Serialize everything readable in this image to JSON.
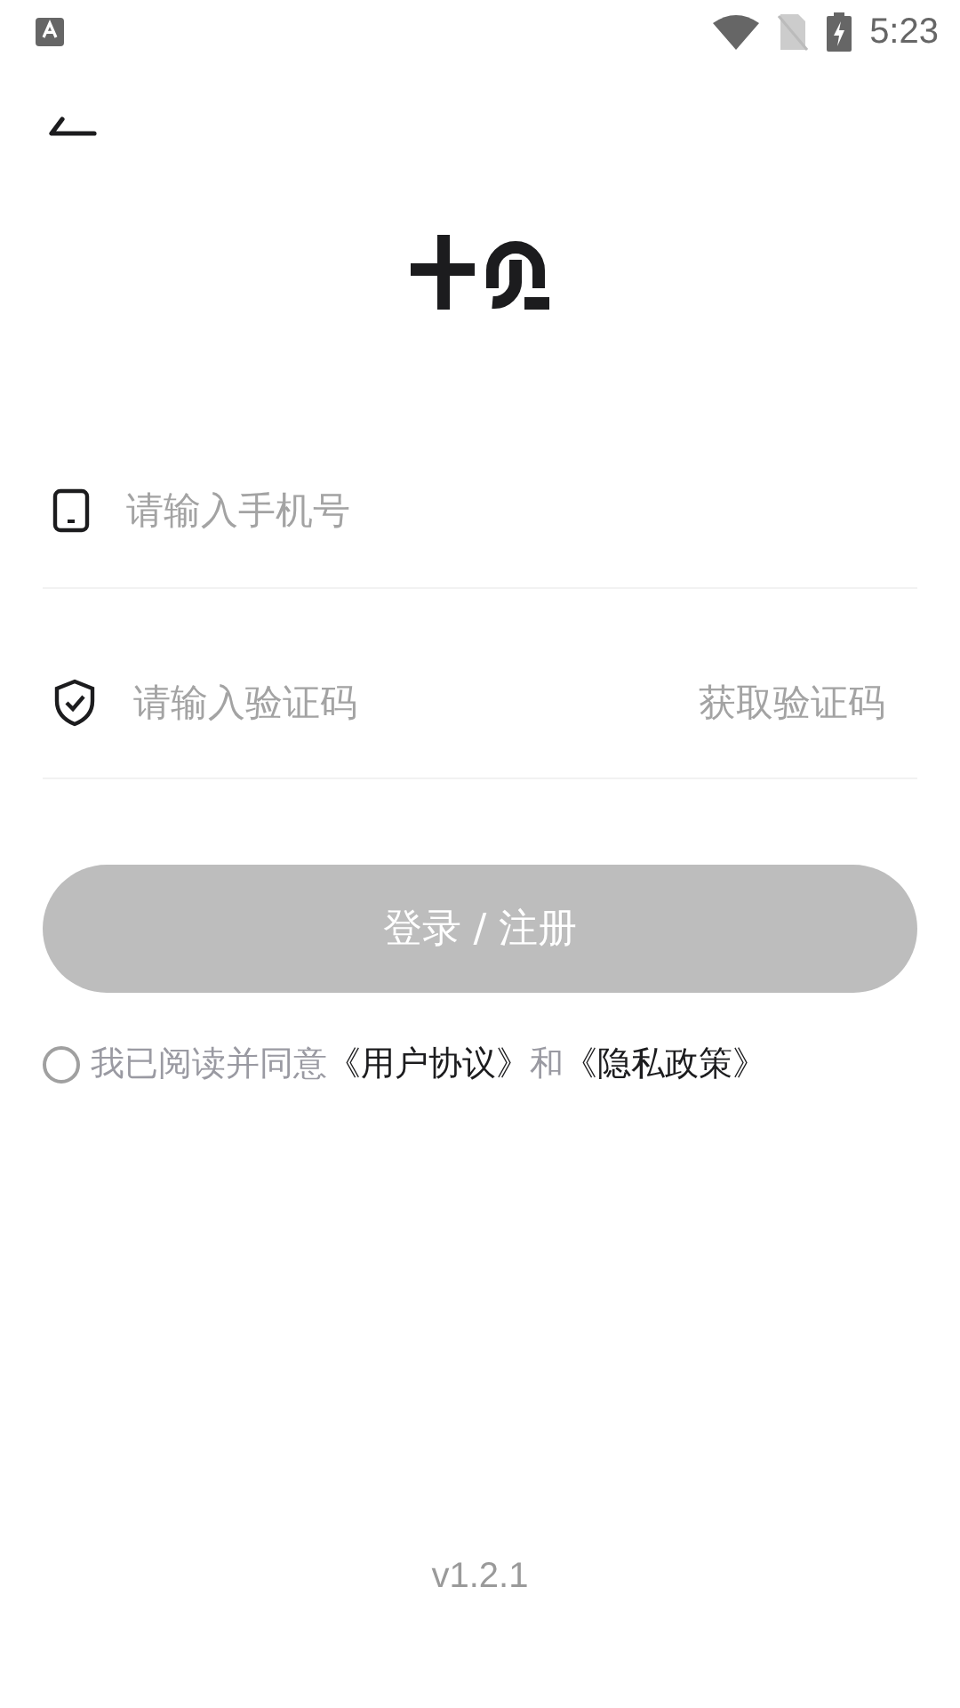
{
  "status_bar": {
    "time": "5:23"
  },
  "phone_field": {
    "placeholder": "请输入手机号"
  },
  "code_field": {
    "placeholder": "请输入验证码",
    "action": "获取验证码"
  },
  "login_button": {
    "label": "登录 / 注册",
    "disabled": true
  },
  "agreement": {
    "checked": false,
    "parts": [
      {
        "kind": "text",
        "text": "我已阅读并同意"
      },
      {
        "kind": "link",
        "text": "《用户协议》"
      },
      {
        "kind": "text",
        "text": "和"
      },
      {
        "kind": "link",
        "text": "《隐私政策》"
      }
    ]
  },
  "version": "v1.2.1"
}
